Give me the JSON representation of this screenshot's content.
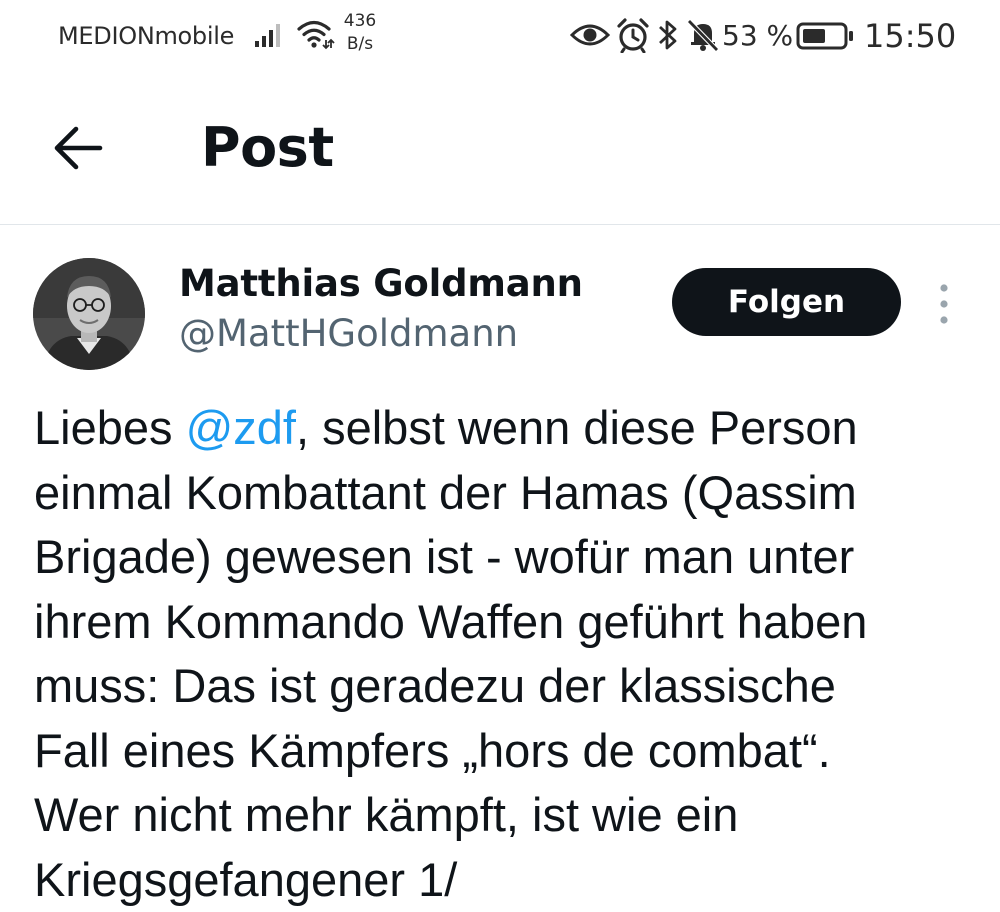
{
  "status_bar": {
    "carrier": "MEDIONmobile",
    "net_speed_value": "436",
    "net_speed_unit": "B/s",
    "battery_percent": "53 %",
    "time": "15:50",
    "icons": [
      "signal-icon",
      "wifi-icon",
      "eye-icon",
      "alarm-icon",
      "bluetooth-icon",
      "bell-muted-icon",
      "battery-icon"
    ]
  },
  "header": {
    "title": "Post"
  },
  "author": {
    "name": "Matthias Goldmann",
    "handle": "@MattHGoldmann",
    "follow_label": "Folgen"
  },
  "post": {
    "line1_before": "Liebes ",
    "mention": "@zdf",
    "line1_after": ", selbst wenn diese Person",
    "lines": [
      "einmal Kombattant der Hamas (Qassim",
      "Brigade) gewesen ist - wofür man unter",
      "ihrem Kommando Waffen geführt haben",
      "muss: Das ist geradezu der klassische",
      "Fall eines Kämpfers „hors de combat“.",
      "Wer nicht mehr kämpft, ist wie ein",
      "Kriegsgefangener 1/"
    ]
  },
  "colors": {
    "accent_link": "#1d9bf0",
    "text_primary": "#0f1419",
    "text_secondary": "#536471",
    "button_bg": "#0f1419"
  }
}
